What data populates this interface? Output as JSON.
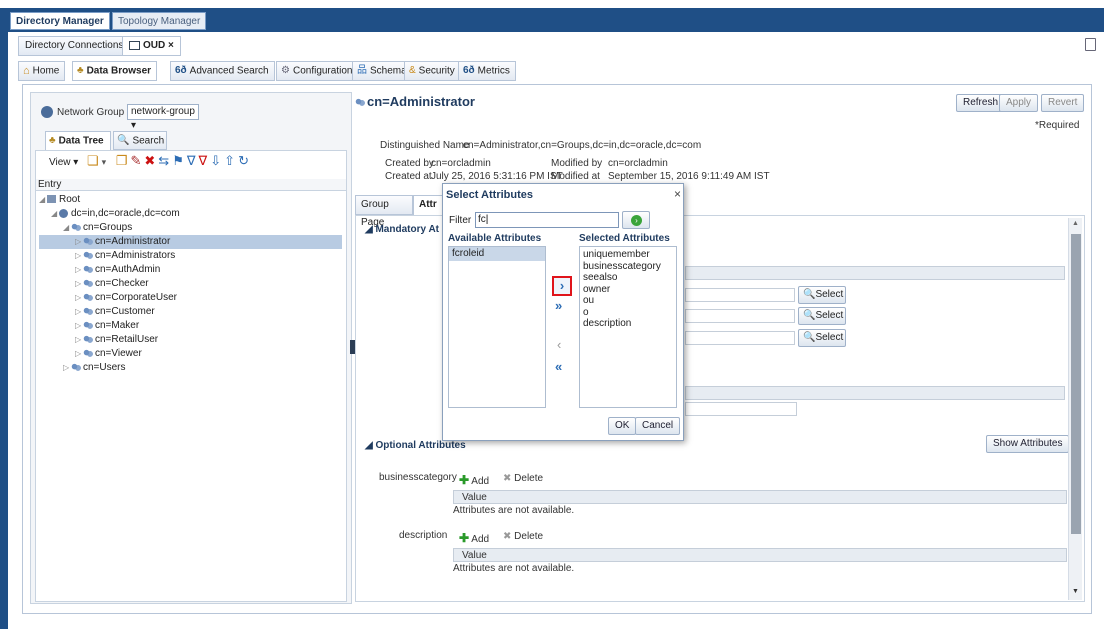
{
  "app_tabs": {
    "directory_manager": "Directory Manager",
    "topology_manager": "Topology Manager"
  },
  "conn_tabs": {
    "directory_connections": "Directory Connections",
    "oud": "OUD"
  },
  "nav_tabs": {
    "home": "Home",
    "data_browser": "Data Browser",
    "advanced_search": "Advanced Search",
    "configuration": "Configuration",
    "schema": "Schema",
    "security": "Security",
    "metrics": "Metrics"
  },
  "left": {
    "network_group_label": "Network Group",
    "network_group_value": "network-group",
    "data_tree_tab": "Data Tree",
    "search_tab": "Search",
    "view_menu": "View",
    "entry_header": "Entry",
    "tree": {
      "root": "Root",
      "base": "dc=in,dc=oracle,dc=com",
      "groups": "cn=Groups",
      "items": [
        "cn=Administrator",
        "cn=Administrators",
        "cn=AuthAdmin",
        "cn=Checker",
        "cn=CorporateUser",
        "cn=Customer",
        "cn=Maker",
        "cn=RetailUser",
        "cn=Viewer"
      ],
      "users": "cn=Users"
    }
  },
  "right": {
    "entry_title": "cn=Administrator",
    "refresh": "Refresh",
    "apply": "Apply",
    "revert": "Revert",
    "required": "*Required",
    "dn_label": "Distinguished Name",
    "dn_value": "cn=Administrator,cn=Groups,dc=in,dc=oracle,dc=com",
    "created_by_label": "Created by",
    "created_by_value": "cn=orcladmin",
    "modified_by_label": "Modified by",
    "modified_by_value": "cn=orcladmin",
    "created_at_label": "Created at",
    "created_at_value": "July 25, 2016 5:31:16 PM IST",
    "modified_at_label": "Modified at",
    "modified_at_value": "September 15, 2016 9:11:49 AM IST",
    "group_page_tab": "Group Page",
    "attr_tab": "Attr",
    "mandatory": "Mandatory At",
    "select": "Select",
    "optional": "Optional Attributes",
    "show_attributes": "Show Attributes",
    "opt_rows": [
      {
        "name": "businesscategory",
        "add": "Add",
        "delete": "Delete",
        "value_header": "Value",
        "empty": "Attributes are not available."
      },
      {
        "name": "description",
        "add": "Add",
        "delete": "Delete",
        "value_header": "Value",
        "empty": "Attributes are not available."
      }
    ]
  },
  "dialog": {
    "title": "Select Attributes",
    "close": "×",
    "filter_label": "Filter",
    "filter_value": "fc",
    "available_header": "Available Attributes",
    "selected_header": "Selected Attributes",
    "available": [
      "fcroleid"
    ],
    "selected": [
      "uniquemember",
      "businesscategory",
      "seealso",
      "owner",
      "ou",
      "o",
      "description"
    ],
    "ok": "OK",
    "cancel": "Cancel"
  },
  "colors": {
    "header_blue": "#1f4f86",
    "highlight_red": "#e0141b",
    "selection_blue": "#b8cbe2"
  }
}
